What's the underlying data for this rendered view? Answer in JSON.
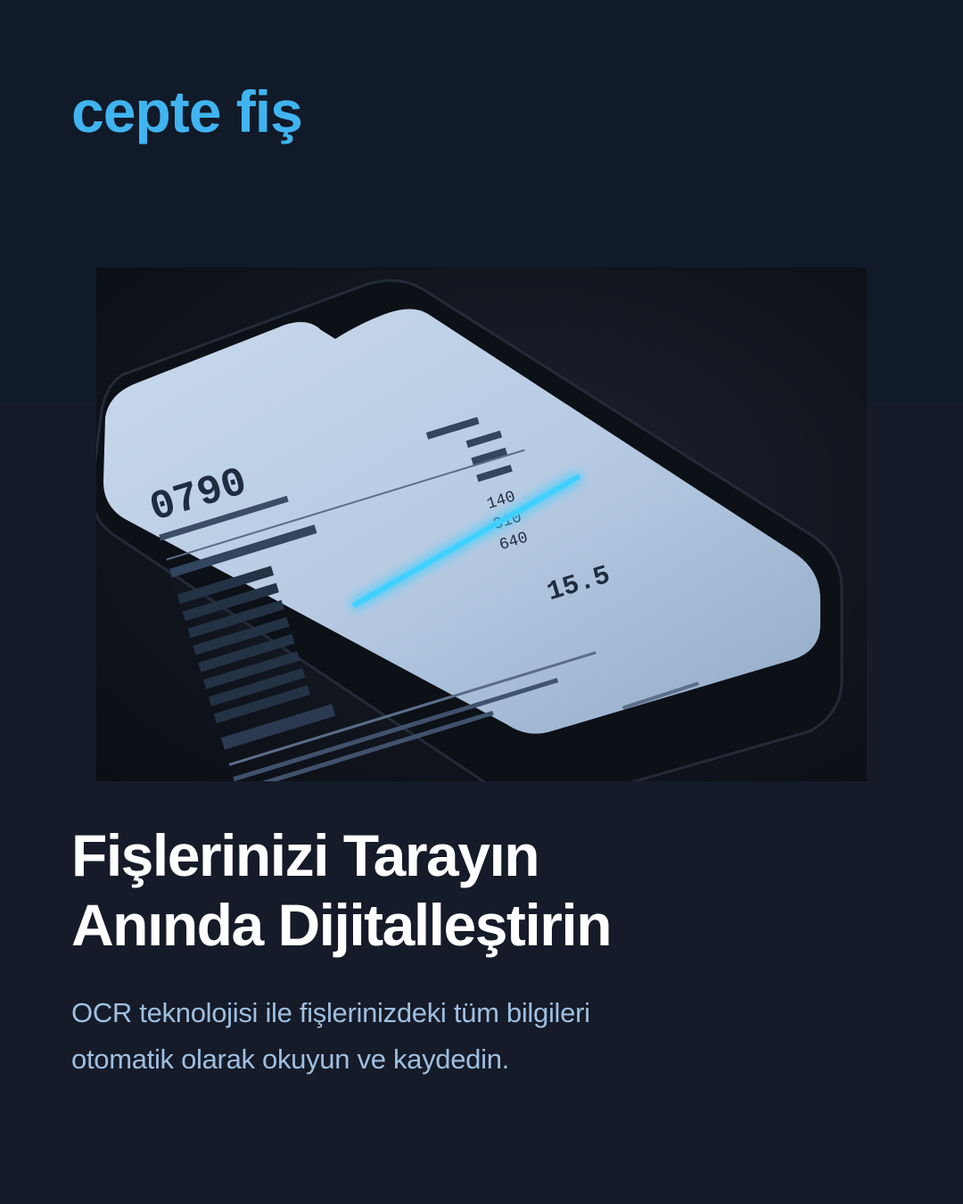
{
  "brand": {
    "name": "cepte fiş",
    "color": "#3fb4f0"
  },
  "hero_image": {
    "icon": "phone-scanning-receipt-illustration",
    "receipt": {
      "header_number": "0790",
      "total": "15.5",
      "side_values": [
        "140",
        "310",
        "640"
      ]
    },
    "scan_line_color": "#3fd0ff"
  },
  "headline": {
    "line1": "Fişlerinizi Tarayın",
    "line2": "Anında Dijitalleştirin"
  },
  "subtitle": {
    "line1": "OCR teknolojisi ile fişlerinizdeki tüm bilgileri",
    "line2": "otomatik olarak okuyun ve kaydedin."
  }
}
